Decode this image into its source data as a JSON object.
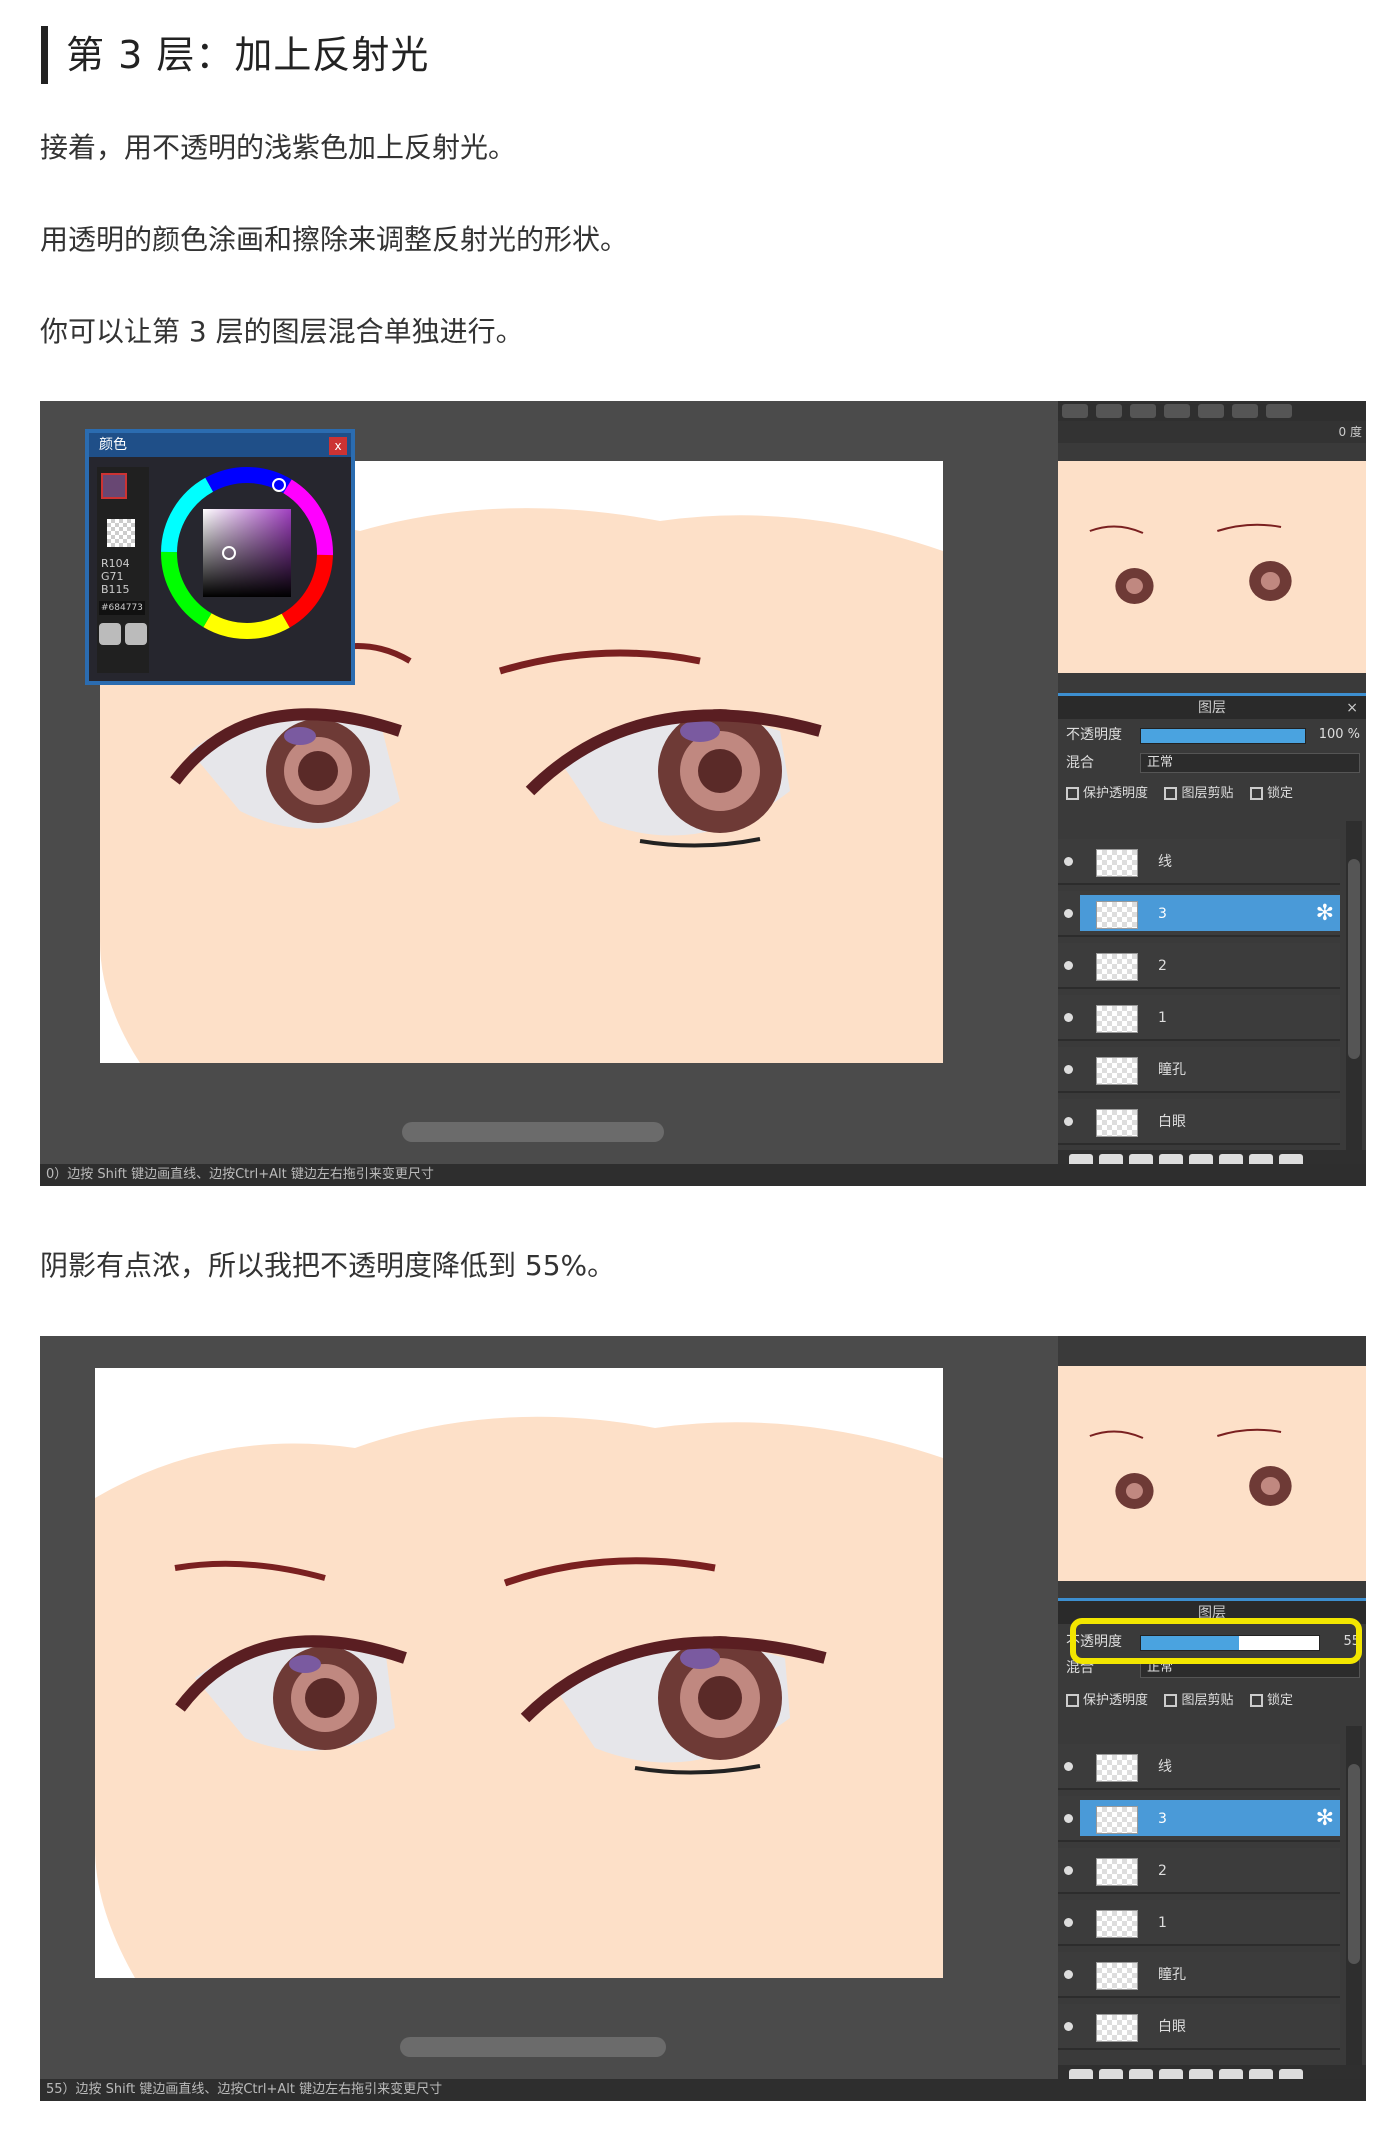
{
  "heading": "第 3 层：加上反射光",
  "paragraphs": {
    "p1": "接着，用不透明的浅紫色加上反射光。",
    "p2": "用透明的颜色涂画和擦除来调整反射光的形状。",
    "p3": "你可以让第 3 层的图层混合单独进行。",
    "p4": "阴影有点浓，所以我把不透明度降低到 55%。"
  },
  "screenshot1": {
    "color_window": {
      "title": "颜色",
      "close": "x",
      "r": "R104",
      "g": "G71",
      "b": "B115",
      "hex": "#684773",
      "main_color": "#684773"
    },
    "status": "0）边按 Shift 键边画直线、边按Ctrl+Alt 键边左右拖引来变更尺寸",
    "nav_value": "0 度",
    "layer_panel": {
      "title": "图层",
      "close": "×",
      "opacity_label": "不透明度",
      "opacity_value": "100 %",
      "opacity": 1.0,
      "blend_label": "混合",
      "blend_value": "正常",
      "chk_protect": "保护透明度",
      "chk_clip": "图层剪贴",
      "chk_lock": "锁定",
      "layers": [
        {
          "name": "线",
          "selected": false
        },
        {
          "name": "3",
          "selected": true
        },
        {
          "name": "2",
          "selected": false
        },
        {
          "name": "1",
          "selected": false
        },
        {
          "name": "瞳孔",
          "selected": false
        },
        {
          "name": "白眼",
          "selected": false
        }
      ],
      "gear": "✻"
    }
  },
  "screenshot2": {
    "status": "55）边按 Shift 键边画直线、边按Ctrl+Alt 键边左右拖引来变更尺寸",
    "layer_panel": {
      "title": "图层",
      "opacity_label": "不透明度",
      "opacity_value": "55",
      "opacity": 0.55,
      "blend_label": "混合",
      "blend_value": "正常",
      "chk_protect": "保护透明度",
      "chk_clip": "图层剪贴",
      "chk_lock": "锁定",
      "layers": [
        {
          "name": "线",
          "selected": false
        },
        {
          "name": "3",
          "selected": true
        },
        {
          "name": "2",
          "selected": false
        },
        {
          "name": "1",
          "selected": false
        },
        {
          "name": "瞳孔",
          "selected": false
        },
        {
          "name": "白眼",
          "selected": false
        }
      ],
      "gear": "✻"
    }
  },
  "colors": {
    "skin": "#fde0c8",
    "iris": "#6e3a36",
    "selected_layer": "#4a9ad8",
    "highlight": "#f2e600"
  }
}
